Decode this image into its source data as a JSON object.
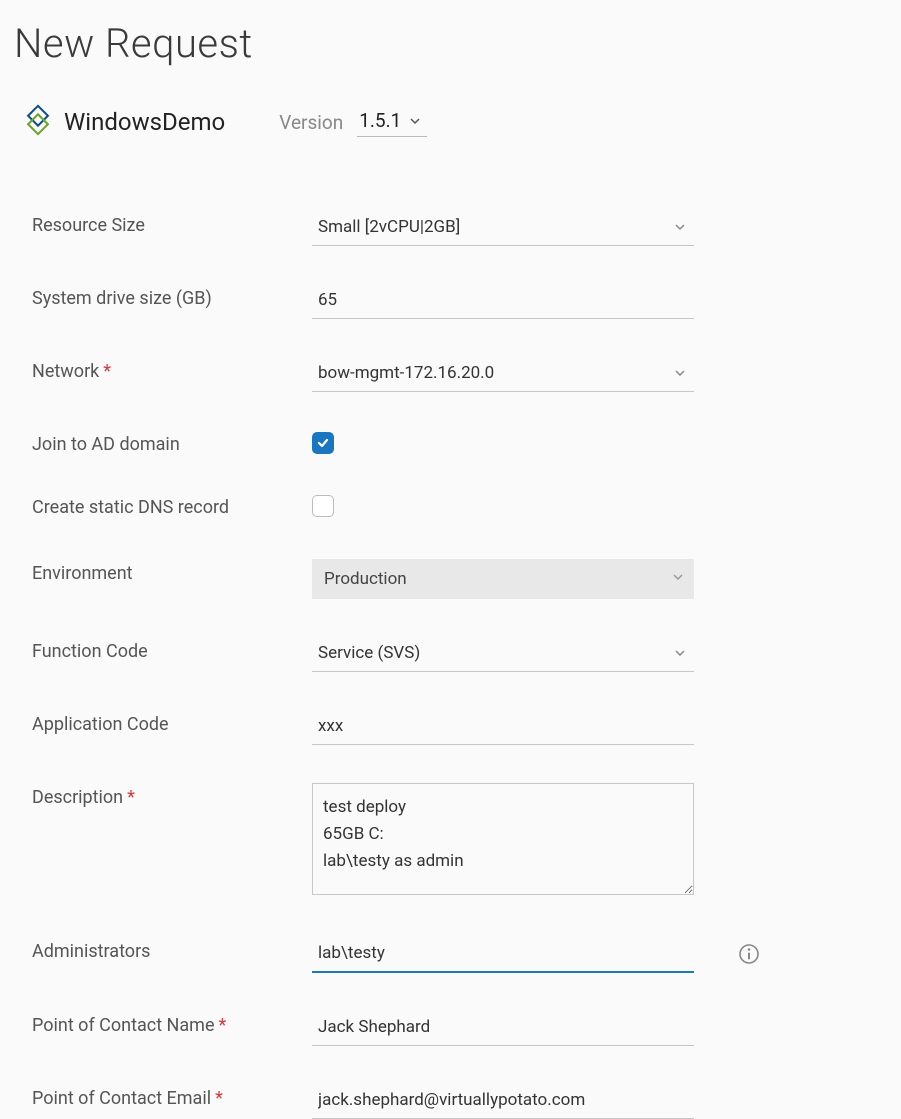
{
  "pageTitle": "New Request",
  "productName": "WindowsDemo",
  "versionLabel": "Version",
  "versionValue": "1.5.1",
  "labels": {
    "resourceSize": "Resource Size",
    "systemDriveSize": "System drive size (GB)",
    "network": "Network",
    "joinAD": "Join to AD domain",
    "createDNS": "Create static DNS record",
    "environment": "Environment",
    "functionCode": "Function Code",
    "applicationCode": "Application Code",
    "description": "Description",
    "administrators": "Administrators",
    "pocName": "Point of Contact Name",
    "pocEmail": "Point of Contact Email"
  },
  "values": {
    "resourceSize": "Small [2vCPU|2GB]",
    "systemDriveSize": "65",
    "network": "bow-mgmt-172.16.20.0",
    "joinAD": true,
    "createDNS": false,
    "environment": "Production",
    "functionCode": "Service (SVS)",
    "applicationCode": "xxx",
    "description": "test deploy\n65GB C:\nlab\\testy as admin",
    "administrators": "lab\\testy",
    "pocName": "Jack Shephard",
    "pocEmail": "jack.shephard@virtuallypotato.com"
  },
  "required": {
    "network": true,
    "description": true,
    "pocName": true,
    "pocEmail": true
  }
}
